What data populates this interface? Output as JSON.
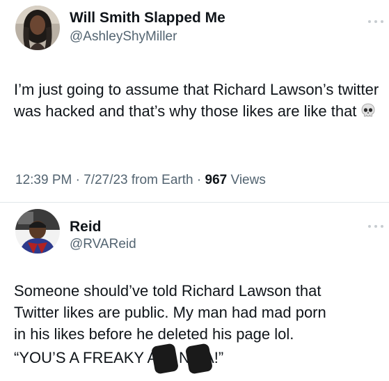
{
  "tweets": [
    {
      "display_name": "Will Smith Slapped Me",
      "handle": "@AshleyShyMiller",
      "text": "I’m just going to assume that Richard Lawson’s twitter was hacked and that’s why those likes are like that",
      "emoji": "skull-emoji",
      "time": "12:39 PM",
      "date": "7/27/23",
      "source": "from Earth",
      "views_count": "967",
      "views_label": "Views",
      "sep": "·"
    },
    {
      "display_name": "Reid",
      "handle": "@RVAReid",
      "text_line1": "Someone should’ve told Richard Lawson that",
      "text_line2": "Twitter likes are public. My man had mad porn",
      "text_line3": "in his likes before he deleted his page lol.",
      "text_line4_a": "“YOU’S A FREAKY A",
      "text_line4_b": "S NI",
      "text_line4_c": "A!”"
    }
  ],
  "icons": {
    "more": "more-horizontal-icon",
    "emoji": "skull-emoji"
  },
  "colors": {
    "text": "#0f1419",
    "secondary": "#536471",
    "background": "#ffffff"
  }
}
